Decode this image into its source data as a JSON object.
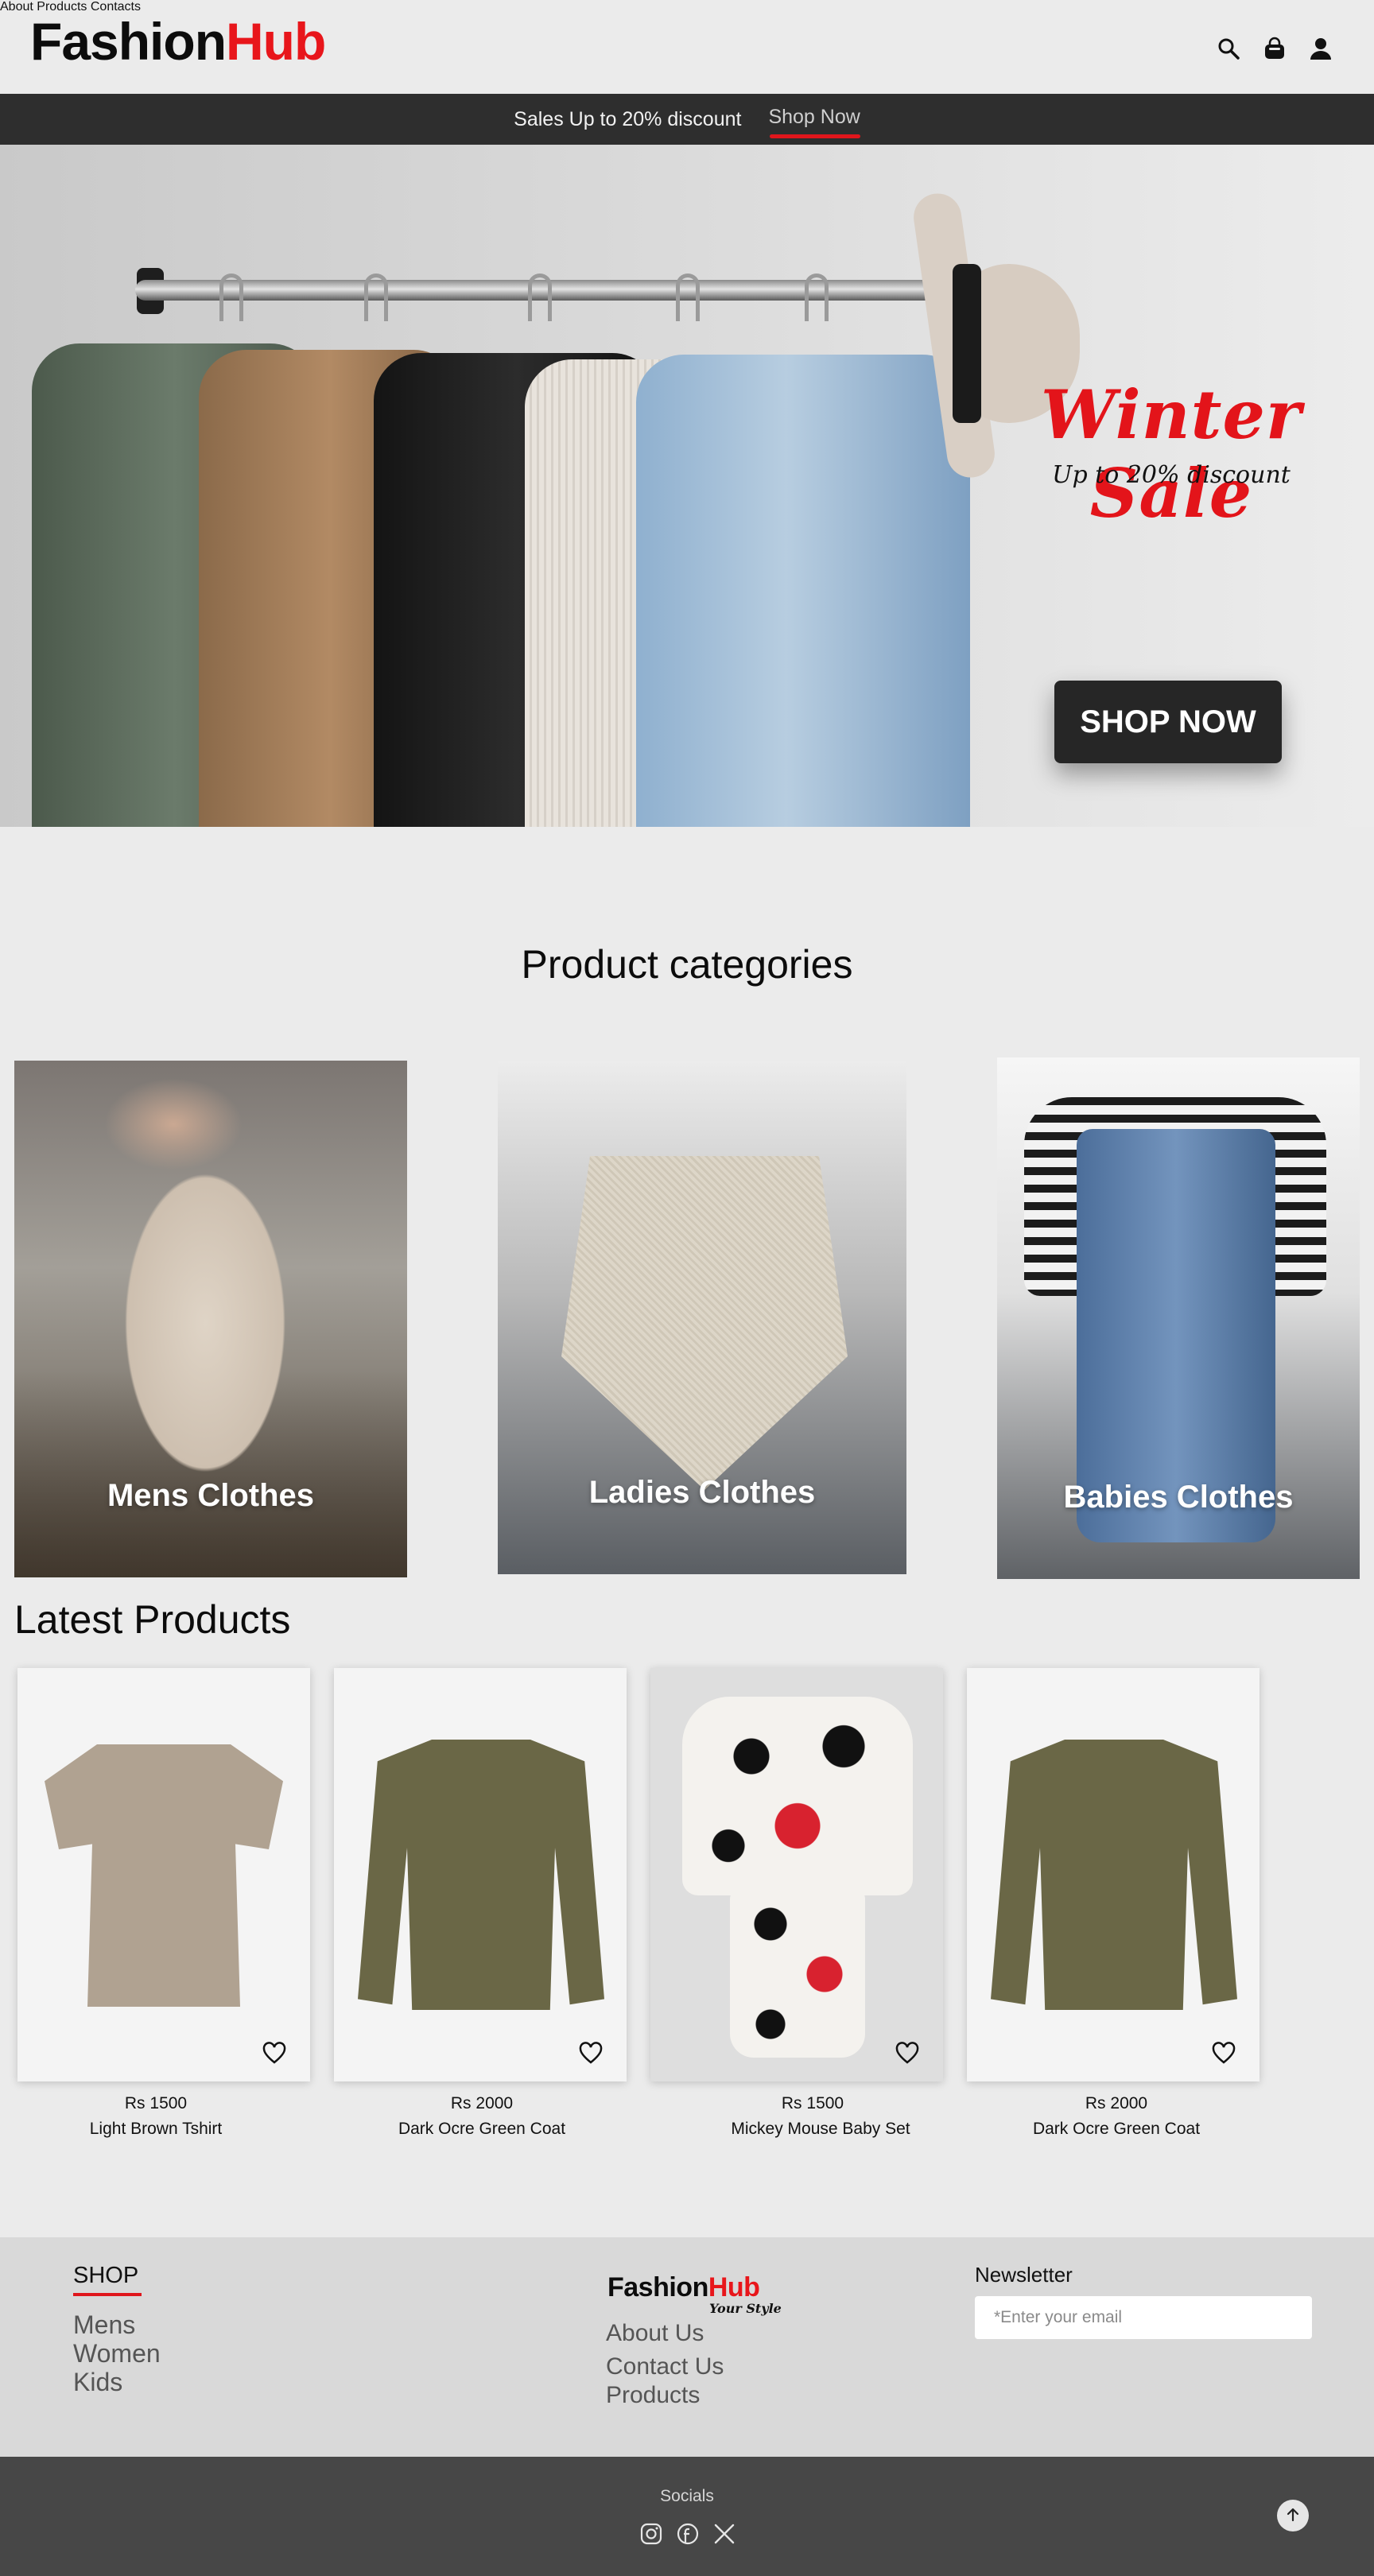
{
  "header": {
    "logo_part1": "Fashion",
    "logo_part2": "Hub",
    "nav": [
      "About",
      "Products",
      "Contacts"
    ],
    "icons": [
      "search-icon",
      "bag-icon",
      "user-icon"
    ]
  },
  "promo": {
    "text": "Sales Up to 20% discount",
    "link": "Shop Now"
  },
  "hero": {
    "title": "Winter Sale",
    "subtitle": "Up to 20% discount",
    "button": "SHOP NOW"
  },
  "categories": {
    "title": "Product categories",
    "items": [
      {
        "label": "Mens Clothes"
      },
      {
        "label": "Ladies Clothes"
      },
      {
        "label": "Babies Clothes"
      }
    ]
  },
  "latest": {
    "title": "Latest Products",
    "products": [
      {
        "price": "Rs 1500",
        "name": "Light Brown Tshirt"
      },
      {
        "price": "Rs 2000",
        "name": "Dark Ocre Green Coat"
      },
      {
        "price": "Rs 1500",
        "name": "Mickey Mouse Baby Set"
      },
      {
        "price": "Rs 2000",
        "name": "Dark Ocre Green Coat"
      }
    ]
  },
  "footer": {
    "shop_title": "SHOP",
    "shop_links": [
      "Mens",
      "Women",
      "Kids"
    ],
    "logo_part1": "Fashion",
    "logo_part2": "Hub",
    "tagline": "Your Style",
    "links": [
      "About Us",
      "Contact Us",
      "Products"
    ],
    "newsletter_title": "Newsletter",
    "newsletter_placeholder": "*Enter your email",
    "socials_title": "Socials",
    "social_icons": [
      "instagram-icon",
      "facebook-icon",
      "x-icon"
    ]
  },
  "colors": {
    "brand_red": "#e8161b",
    "dark_bar": "#2e2e2e",
    "footer_bg": "#d9d9d9",
    "bottom_bg": "#474747"
  }
}
